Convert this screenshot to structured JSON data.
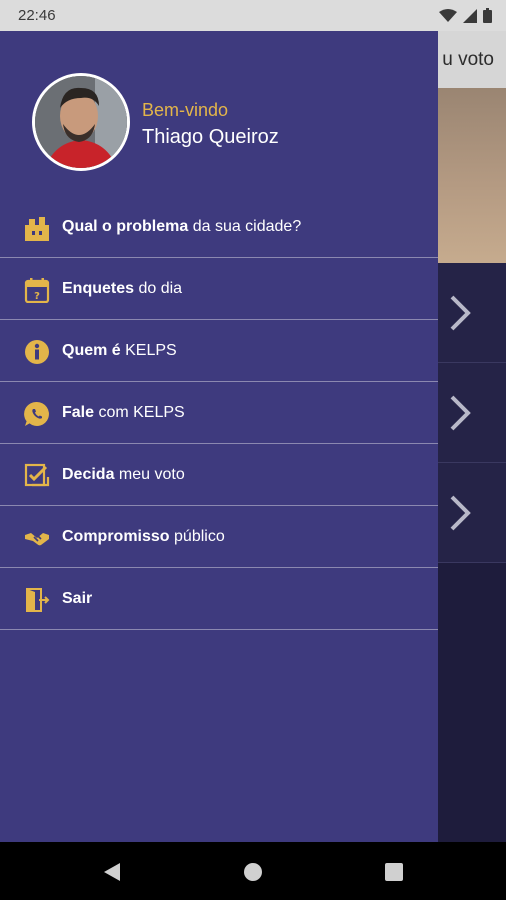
{
  "status_bar": {
    "time": "22:46"
  },
  "background": {
    "toolbar_title": "u voto"
  },
  "drawer": {
    "welcome": "Bem-vindo",
    "user_name": "Thiago Queiroz",
    "items": [
      {
        "bold": "Qual o problema",
        "light": " da sua cidade?",
        "icon": "city-icon"
      },
      {
        "bold": "Enquetes",
        "light": " do dia",
        "icon": "calendar-icon"
      },
      {
        "bold": "Quem é",
        "light": " KELPS",
        "icon": "info-icon"
      },
      {
        "bold": "Fale",
        "light": " com KELPS",
        "icon": "whatsapp-icon"
      },
      {
        "bold": "Decida",
        "light": " meu voto",
        "icon": "ballot-check-icon"
      },
      {
        "bold": "Compromisso",
        "light": " público",
        "icon": "handshake-icon"
      },
      {
        "bold": "Sair",
        "light": "",
        "icon": "exit-door-icon"
      }
    ]
  },
  "colors": {
    "drawer_bg": "#3e3a7e",
    "accent": "#e3b54a",
    "divider": "#8b88b0"
  }
}
